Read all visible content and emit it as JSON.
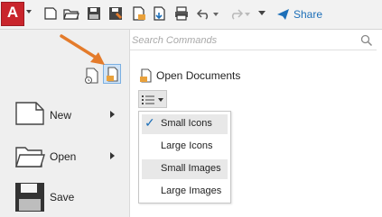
{
  "toolbar": {
    "app_letter": "A",
    "share_label": "Share",
    "icons": [
      "new-file-icon",
      "open-folder-icon",
      "save-icon",
      "save-as-icon",
      "open-from-web-icon",
      "save-to-web-icon",
      "print-icon",
      "undo-icon",
      "redo-icon",
      "customize-dropdown-icon",
      "share-icon"
    ]
  },
  "search": {
    "placeholder": "Search Commands"
  },
  "left_menu": {
    "items": [
      {
        "label": "New",
        "has_submenu": true
      },
      {
        "label": "Open",
        "has_submenu": true
      },
      {
        "label": "Save",
        "has_submenu": false
      }
    ]
  },
  "right_panel": {
    "title": "Open Documents",
    "view_menu": {
      "options": [
        {
          "label": "Small Icons",
          "checked": true,
          "highlighted": true
        },
        {
          "label": "Large Icons",
          "checked": false,
          "highlighted": false
        },
        {
          "label": "Small Images",
          "checked": false,
          "highlighted": true
        },
        {
          "label": "Large Images",
          "checked": false,
          "highlighted": false
        }
      ]
    }
  },
  "colors": {
    "accent": "#1d6fb8",
    "app_red": "#c9252c",
    "annotation_arrow": "#e47b2b"
  }
}
